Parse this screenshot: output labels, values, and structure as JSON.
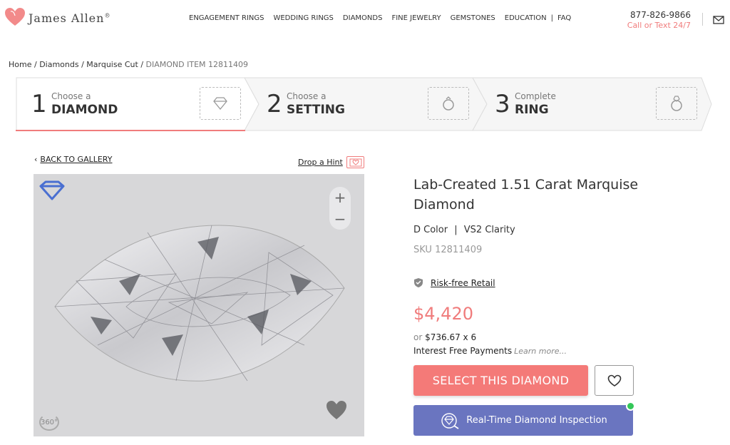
{
  "header": {
    "brand": "James Allen",
    "trademark": "®",
    "nav": [
      "ENGAGEMENT RINGS",
      "WEDDING RINGS",
      "DIAMONDS",
      "FINE JEWELRY",
      "GEMSTONES",
      "EDUCATION"
    ],
    "nav_faq": "FAQ",
    "phone": "877-826-9866",
    "call_text": "Call or Text 24/7"
  },
  "breadcrumb": {
    "home": "Home",
    "diamonds": "Diamonds",
    "cut": "Marquise Cut",
    "current": "DIAMOND ITEM 12811409",
    "sep": " / "
  },
  "steps": [
    {
      "num": "1",
      "small": "Choose a",
      "big": "DIAMOND"
    },
    {
      "num": "2",
      "small": "Choose a",
      "big": "SETTING"
    },
    {
      "num": "3",
      "small": "Complete",
      "big": "RING"
    }
  ],
  "gallery": {
    "back": "BACK TO GALLERY",
    "hint": "Drop a Hint",
    "zoom_in": "+",
    "zoom_out": "−",
    "rotate_label": "360°"
  },
  "product": {
    "title": "Lab-Created 1.51 Carat Marquise Diamond",
    "color": "D Color",
    "clarity": "VS2 Clarity",
    "spec_sep": "|",
    "sku": "SKU 12811409",
    "risk": "Risk-free Retail",
    "price": "$4,420",
    "monthly_or": "or",
    "monthly": "$736.67 x 6",
    "interest": "Interest Free Payments",
    "learn_more": "Learn more...",
    "select_label": "SELECT THIS DIAMOND",
    "inspect_label": "Real-Time Diamond Inspection"
  },
  "colors": {
    "accent": "#f07c7c",
    "select_bg": "#f47a78",
    "inspect_bg": "#6a75c0",
    "live_dot": "#34c759",
    "diamond_icon": "#4a6fd1"
  },
  "icons": {
    "logo": "heart-logo-icon",
    "mail": "mail-icon",
    "step_diamond": "diamond-icon",
    "step_setting": "ring-setting-icon",
    "step_ring": "ring-icon",
    "back": "chevron-left-icon",
    "hint": "heart-envelope-icon",
    "shape": "marquise-shape-icon",
    "rotate": "rotate-360-icon",
    "heart_badge": "heart-badge-icon",
    "shield": "shield-check-icon",
    "wishlist": "heart-outline-icon",
    "inspect": "diamond-inspect-icon"
  }
}
